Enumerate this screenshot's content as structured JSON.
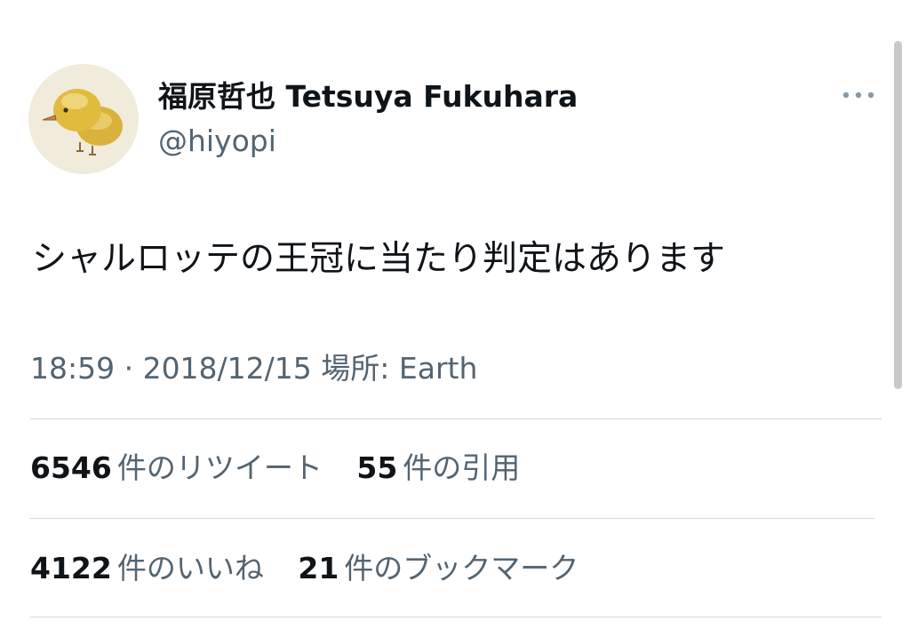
{
  "user": {
    "display_name": "福原哲也 Tetsuya Fukuhara",
    "handle": "@hiyopi",
    "avatar_icon": "chick-avatar-icon"
  },
  "tweet": {
    "text": "シャルロッテの王冠に当たり判定はあります",
    "meta": "18:59 · 2018/12/15 場所: Earth"
  },
  "stats": {
    "retweets": {
      "count": "6546",
      "label": "件のリツイート"
    },
    "quotes": {
      "count": "55",
      "label": "件の引用"
    },
    "likes": {
      "count": "4122",
      "label": "件のいいね"
    },
    "bookmarks": {
      "count": "21",
      "label": "件のブックマーク"
    }
  },
  "colors": {
    "primary_text": "#0f1419",
    "secondary_text": "#536471",
    "divider": "#cfd9de"
  }
}
